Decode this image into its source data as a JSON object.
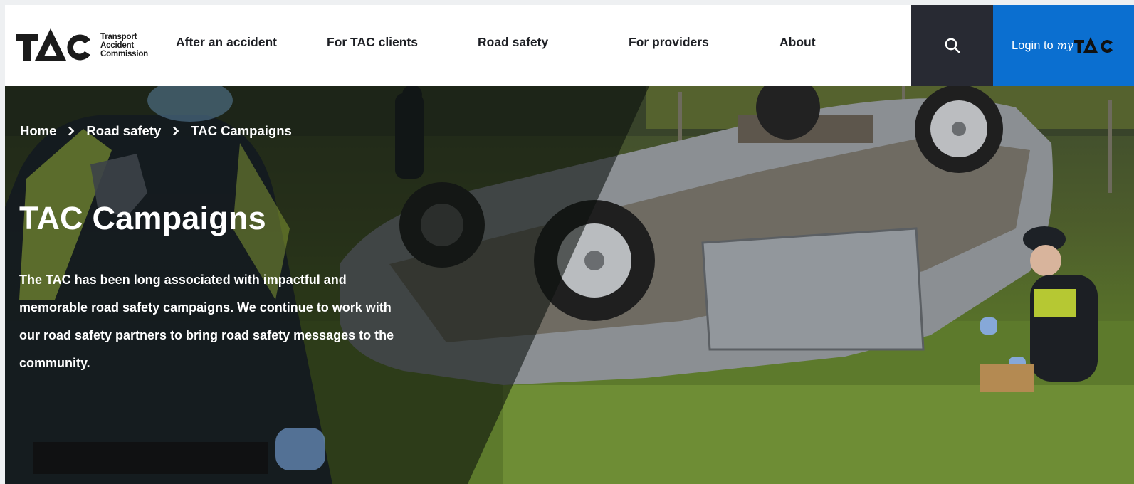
{
  "header": {
    "logo_lines": [
      "Transport",
      "Accident",
      "Commission"
    ],
    "nav": [
      {
        "label": "After an accident"
      },
      {
        "label": "For TAC clients"
      },
      {
        "label": "Road safety"
      },
      {
        "label": "For providers"
      },
      {
        "label": "About"
      }
    ],
    "search_icon": "search-icon",
    "login_label": "Login to",
    "login_brand": "my",
    "colors": {
      "search_bg": "#282a33",
      "login_bg": "#0b6fd0"
    }
  },
  "breadcrumb": [
    {
      "label": "Home"
    },
    {
      "label": "Road safety"
    },
    {
      "label": "TAC Campaigns"
    }
  ],
  "hero": {
    "title": "TAC Campaigns",
    "body": "The TAC has been long associated with impactful and memorable road safety campaigns. We continue to work with our road safety partners to bring road safety messages to the community."
  }
}
